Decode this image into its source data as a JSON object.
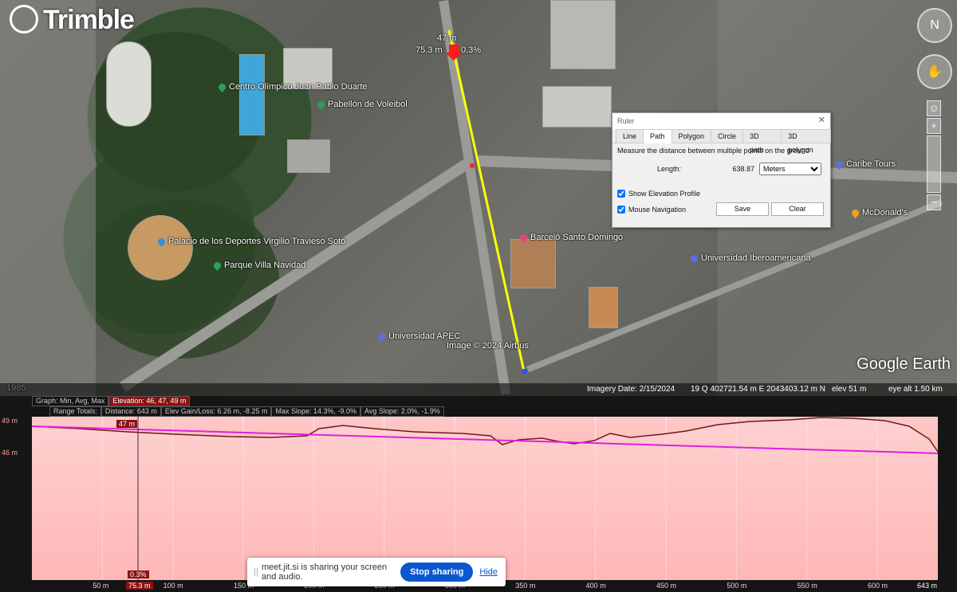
{
  "app": {
    "logo_text": "Trimble"
  },
  "map": {
    "pois": [
      {
        "name": "Centro Olímpico Juan Pablo Duarte",
        "color": "#2e9e5a"
      },
      {
        "name": "Pabellón de Voleibol",
        "color": "#2e9e5a"
      },
      {
        "name": "Palacio de los Deportes Virgilio Travieso Soto",
        "color": "#3a8ed6"
      },
      {
        "name": "Parque Villa Navidad",
        "color": "#2e9e5a"
      },
      {
        "name": "Barceló Santo Domingo",
        "color": "#e2457a"
      },
      {
        "name": "Universidad Iberoamericana",
        "color": "#5b6fd6"
      },
      {
        "name": "Universidad APEC",
        "color": "#5b6fd6"
      },
      {
        "name": "Caribe Tours",
        "color": "#5b6fd6"
      },
      {
        "name": "McDonald's",
        "color": "#f0a21b"
      },
      {
        "name": "Image © 2024 Airbus",
        "color": "#ffffff"
      }
    ],
    "ruler_marker_elev": "47 m",
    "ruler_marker_dist": "75.3 m",
    "ruler_marker_slope": "0.3%",
    "watermark": "Google Earth",
    "year_tag": "1985",
    "status": {
      "imagery": "Imagery Date: 2/15/2024",
      "coords": "19 Q 402721.54 m E 2043403.12 m N",
      "elev": "elev   51 m",
      "eye": "eye alt   1.50 km"
    }
  },
  "ruler": {
    "title": "Ruler",
    "close": "✕",
    "tabs": [
      "Line",
      "Path",
      "Polygon",
      "Circle",
      "3D path",
      "3D polygon"
    ],
    "active_tab": 1,
    "description": "Measure the distance between multiple points on the ground",
    "length_label": "Length:",
    "length_value": "638.87",
    "unit": "Meters",
    "show_profile": "Show Elevation Profile",
    "mouse_nav": "Mouse Navigation",
    "save": "Save",
    "clear": "Clear"
  },
  "profile": {
    "legend": {
      "graph": "Graph: Min, Avg, Max",
      "elevation": "Elevation: 46, 47, 49 m",
      "range": "Range Totals:",
      "distance": "Distance: 643 m",
      "gain": "Elev Gain/Loss: 6.26 m, -8.25 m",
      "max_slope": "Max Slope: 14.3%, -9.0%",
      "avg_slope": "Avg Slope: 2.0%, -1.9%"
    },
    "y_ticks": [
      "49 m",
      "46 m"
    ],
    "x_ticks": [
      "50 m",
      "100 m",
      "150 m",
      "200 m",
      "250 m",
      "300 m",
      "350 m",
      "400 m",
      "450 m",
      "500 m",
      "550 m",
      "600 m"
    ],
    "x_end": "643 m",
    "cursor_x": "75.3 m",
    "cursor_elev": "47 m",
    "cursor_slope": "0.3%",
    "colors": {
      "terrain": "#6e1a1a",
      "slope_line": "#e020e0",
      "fill": "#ffb3b3"
    }
  },
  "jitsi": {
    "message": "meet.jit.si is sharing your screen and audio.",
    "stop": "Stop sharing",
    "hide": "Hide"
  }
}
